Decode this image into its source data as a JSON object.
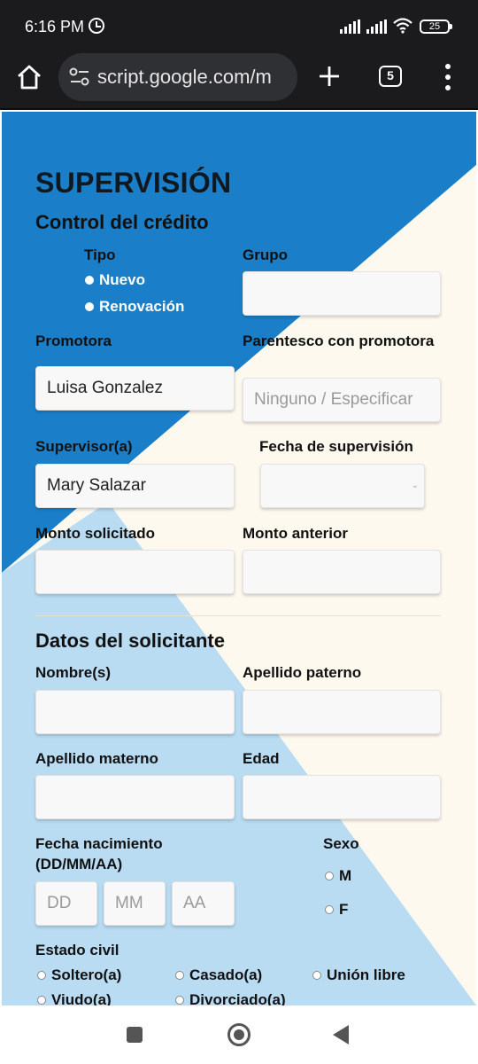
{
  "status": {
    "time": "6:16 PM",
    "battery": "25"
  },
  "browser": {
    "url": "script.google.com/m",
    "tab_count": "5"
  },
  "form": {
    "title": "SUPERVISIÓN",
    "credit_section": "Control del crédito",
    "tipo_label": "Tipo",
    "tipo_options": [
      "Nuevo",
      "Renovación"
    ],
    "grupo_label": "Grupo",
    "grupo_value": "",
    "promotora_label": "Promotora",
    "promotora_value": "Luisa Gonzalez",
    "parentesco_label": "Parentesco con promotora",
    "parentesco_placeholder": "Ninguno / Especificar",
    "supervisor_label": "Supervisor(a)",
    "supervisor_value": "Mary Salazar",
    "fecha_sup_label": "Fecha de supervisión",
    "monto_sol_label": "Monto solicitado",
    "monto_ant_label": "Monto anterior",
    "applicant_section": "Datos del solicitante",
    "nombre_label": "Nombre(s)",
    "ap_paterno_label": "Apellido paterno",
    "ap_materno_label": "Apellido materno",
    "edad_label": "Edad",
    "fecha_nac_label": "Fecha nacimiento (DD/MM/AA)",
    "dd_placeholder": "DD",
    "mm_placeholder": "MM",
    "aa_placeholder": "AA",
    "sexo_label": "Sexo",
    "sexo_options": [
      "M",
      "F"
    ],
    "estado_civil_label": "Estado civil",
    "estado_civil_options": [
      "Soltero(a)",
      "Casado(a)",
      "Unión libre",
      "Viudo(a)",
      "Divorciado(a)"
    ]
  },
  "colors": {
    "dark_blue": "#1a7fc8",
    "light_blue": "#b9dcf3",
    "cream": "#fdf9ee"
  }
}
